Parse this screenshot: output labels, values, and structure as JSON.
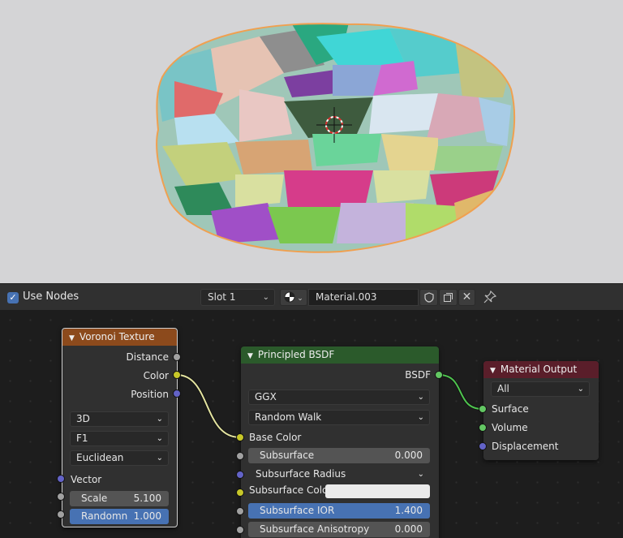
{
  "header": {
    "use_nodes_label": "Use Nodes",
    "use_nodes_checked": true,
    "slot_label": "Slot 1",
    "material_name": "Material.003"
  },
  "nodes": {
    "voronoi": {
      "title": "Voronoi Texture",
      "outputs": [
        "Distance",
        "Color",
        "Position"
      ],
      "dimensions": "3D",
      "feature": "F1",
      "metric": "Euclidean",
      "vector_label": "Vector",
      "scale_label": "Scale",
      "scale_value": "5.100",
      "randomness_label": "Randomn",
      "randomness_value": "1.000",
      "header_color": "#8c4a1c"
    },
    "principled": {
      "title": "Principled BSDF",
      "output": "BSDF",
      "distribution": "GGX",
      "subsurface_method": "Random Walk",
      "base_color_label": "Base Color",
      "subsurface_label": "Subsurface",
      "subsurface_value": "0.000",
      "subsurface_radius_label": "Subsurface Radius",
      "subsurface_color_label": "Subsurface Colo",
      "subsurface_ior_label": "Subsurface IOR",
      "subsurface_ior_value": "1.400",
      "subsurface_aniso_label": "Subsurface Anisotropy",
      "subsurface_aniso_value": "0.000",
      "header_color": "#2b5a2b"
    },
    "output": {
      "title": "Material Output",
      "target": "All",
      "inputs": [
        "Surface",
        "Volume",
        "Displacement"
      ],
      "header_color": "#5a1e2a"
    }
  },
  "colors": {
    "accent": "#4772b3",
    "socket_color": "#c7c729",
    "socket_shader": "#63c763",
    "socket_vector": "#6363c7",
    "socket_float": "#a1a1a1"
  }
}
